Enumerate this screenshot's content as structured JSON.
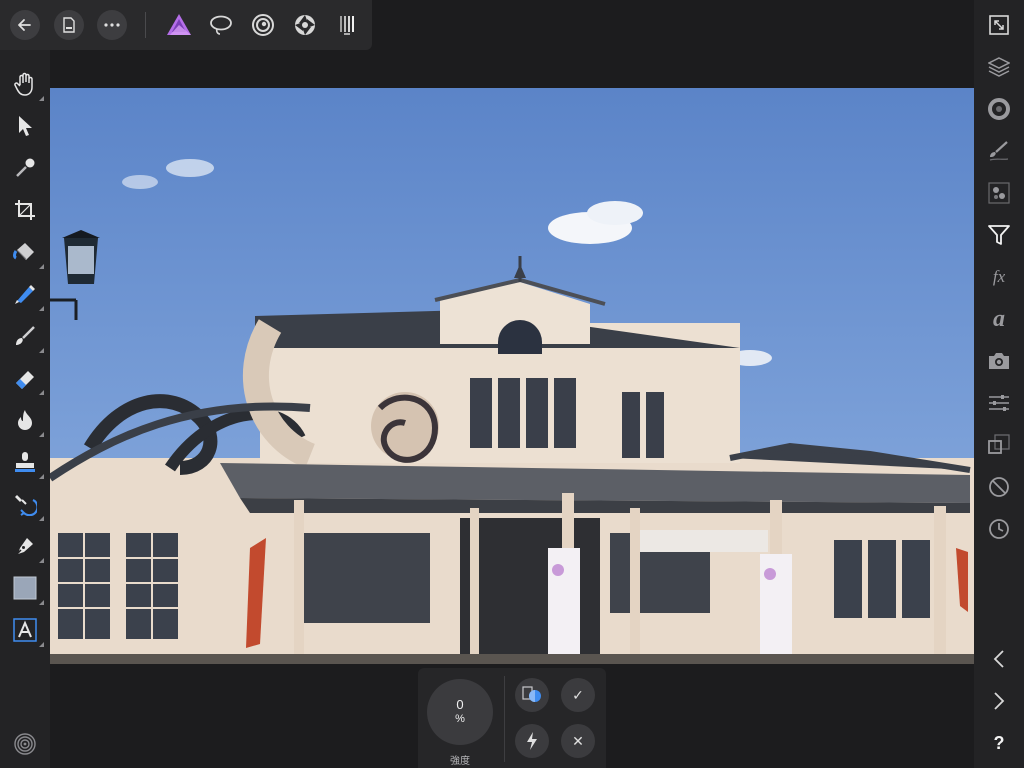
{
  "app": {
    "name": "Affinity Photo",
    "accent_color": "#9b59d6"
  },
  "topbar": {
    "back": {
      "icon": "back-arrow-icon"
    },
    "document": {
      "icon": "document-icon"
    },
    "more": {
      "icon": "more-dots-icon"
    },
    "personas": [
      {
        "name": "photo-persona",
        "icon": "affinity-photo-icon",
        "active": true
      },
      {
        "name": "selection-persona",
        "icon": "lasso-icon"
      },
      {
        "name": "liquify-persona",
        "icon": "liquify-swirl-icon"
      },
      {
        "name": "develop-persona",
        "icon": "aperture-icon"
      },
      {
        "name": "tone-mapping-persona",
        "icon": "tone-mapping-icon"
      }
    ]
  },
  "left_tools": [
    {
      "name": "view-tool",
      "icon": "hand-icon"
    },
    {
      "name": "move-tool",
      "icon": "pointer-arrow-icon"
    },
    {
      "name": "color-picker-tool",
      "icon": "eyedropper-icon"
    },
    {
      "name": "crop-tool",
      "icon": "crop-icon"
    },
    {
      "name": "flood-fill-tool",
      "icon": "paint-bucket-icon"
    },
    {
      "name": "selection-brush-tool",
      "icon": "selection-brush-icon"
    },
    {
      "name": "paint-brush-tool",
      "icon": "paint-brush-icon"
    },
    {
      "name": "erase-brush-tool",
      "icon": "eraser-icon"
    },
    {
      "name": "dodge-burn-tool",
      "icon": "flame-icon"
    },
    {
      "name": "clone-brush-tool",
      "icon": "stamp-icon"
    },
    {
      "name": "healing-tool",
      "icon": "healing-icon"
    },
    {
      "name": "pen-tool",
      "icon": "pen-nib-icon"
    },
    {
      "name": "rectangle-tool",
      "icon": "rectangle-shape-icon"
    },
    {
      "name": "artistic-text-tool",
      "icon": "text-a-icon"
    }
  ],
  "right_studios": [
    {
      "name": "fullscreen-studio",
      "icon": "fullscreen-icon"
    },
    {
      "name": "layers-studio",
      "icon": "layers-icon"
    },
    {
      "name": "color-studio",
      "icon": "color-wheel-icon"
    },
    {
      "name": "brushes-studio",
      "icon": "brush-studio-icon"
    },
    {
      "name": "channels-studio",
      "icon": "channels-icon"
    },
    {
      "name": "filters-studio",
      "icon": "funnel-filter-icon",
      "active": true
    },
    {
      "name": "effects-studio",
      "icon": "fx-icon",
      "label": "fx"
    },
    {
      "name": "text-studio",
      "icon": "text-italic-a-icon",
      "label": "a"
    },
    {
      "name": "snapshots-studio",
      "icon": "camera-icon"
    },
    {
      "name": "adjustments-studio",
      "icon": "sliders-icon"
    },
    {
      "name": "transform-studio",
      "icon": "transform-squares-icon"
    },
    {
      "name": "navigator-studio",
      "icon": "no-entry-icon"
    },
    {
      "name": "history-studio",
      "icon": "clock-icon"
    }
  ],
  "right_nav": {
    "prev": {
      "icon": "chevron-left-icon"
    },
    "next": {
      "icon": "chevron-right-icon"
    },
    "help": {
      "icon": "help-icon",
      "label": "?"
    }
  },
  "bottom_panel": {
    "strength": {
      "value": "0",
      "unit": "%",
      "label": "強度"
    },
    "buttons": [
      {
        "name": "compare-button",
        "icon": "compare-split-icon"
      },
      {
        "name": "apply-button",
        "icon": "check-icon",
        "label": "✓"
      },
      {
        "name": "lightning-button",
        "icon": "lightning-icon"
      },
      {
        "name": "cancel-button",
        "icon": "close-icon",
        "label": "✕"
      }
    ]
  },
  "left_footer": {
    "icon": "spiral-menu-icon"
  },
  "canvas": {
    "description_color_sky": "#5c86c9",
    "subject": "train station photo with twirl distortion"
  }
}
